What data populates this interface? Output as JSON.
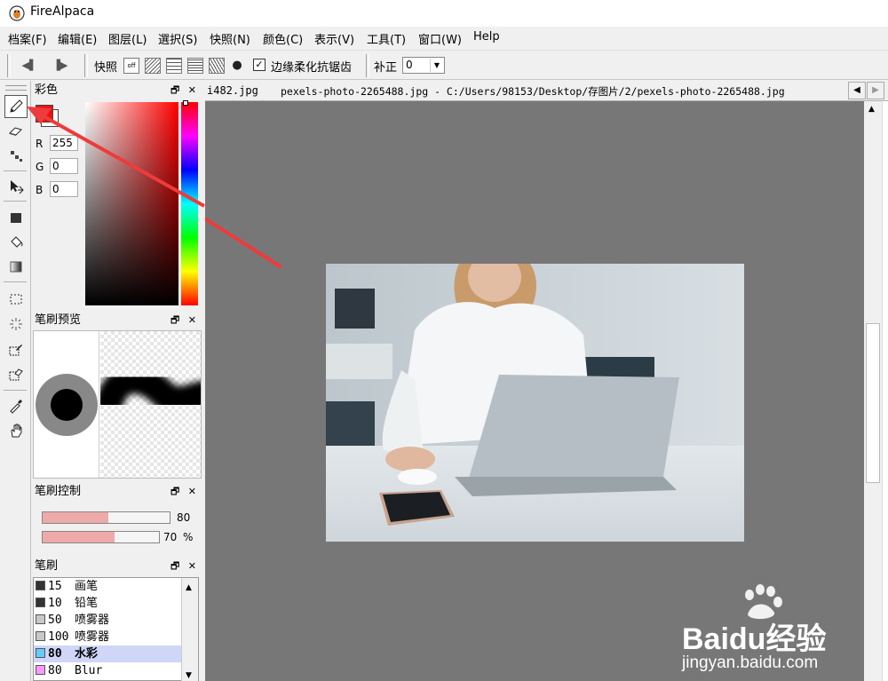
{
  "app": {
    "title": "FireAlpaca"
  },
  "menu": [
    "档案(F)",
    "编辑(E)",
    "图层(L)",
    "選択(S)",
    "快照(N)",
    "颜色(C)",
    "表示(V)",
    "工具(T)",
    "窗口(W)",
    "Help"
  ],
  "toolbar": {
    "snap_label": "快照",
    "snap_off": "off",
    "antialias_label": "边缘柔化抗锯齿",
    "antialias_checked": true,
    "correction_label": "补正",
    "correction_value": "0"
  },
  "tabs": {
    "partial": "i482.jpg",
    "active": "pexels-photo-2265488.jpg - C:/Users/98153/Desktop/存图片/2/pexels-photo-2265488.jpg"
  },
  "color_panel": {
    "title": "彩色",
    "r_label": "R",
    "r_value": "255",
    "g_label": "G",
    "g_value": "0",
    "b_label": "B",
    "b_value": "0",
    "primary": "#ee1111"
  },
  "preview_panel": {
    "title": "笔刷预览"
  },
  "control_panel": {
    "title": "笔刷控制",
    "size_value": "80",
    "opacity_value": "70",
    "opacity_unit": "%",
    "size_fill": 0.52,
    "opacity_fill": 0.62
  },
  "brush_panel": {
    "title": "笔刷",
    "items": [
      {
        "size": "15",
        "name": "画笔",
        "color": "#333333"
      },
      {
        "size": "10",
        "name": "铅笔",
        "color": "#333333"
      },
      {
        "size": "50",
        "name": "喷雾器",
        "color": "#c8c8c8"
      },
      {
        "size": "100",
        "name": "喷雾器",
        "color": "#c8c8c8"
      },
      {
        "size": "80",
        "name": "水彩",
        "color": "#66ccff",
        "selected": true
      },
      {
        "size": "80",
        "name": "Blur",
        "color": "#ff99ff"
      }
    ]
  },
  "panel_buttons": "🗗 ✕",
  "watermark": {
    "brand": "Baidu经验",
    "url": "jingyan.baidu.com"
  }
}
